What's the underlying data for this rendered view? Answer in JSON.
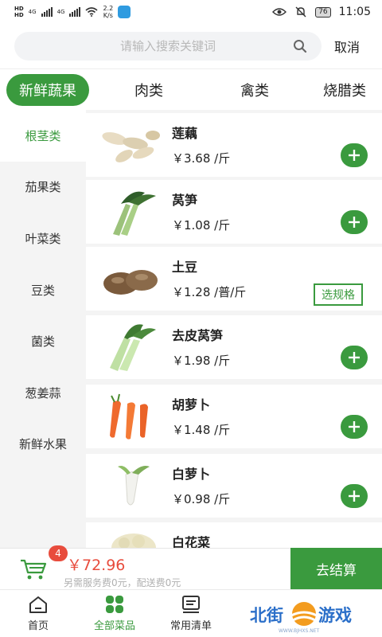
{
  "status_bar": {
    "left_text_1": "HD",
    "left_text_2": "HD",
    "net_4g_1": "4G",
    "net_4g_2": "4G",
    "net_speed": "2.2",
    "net_unit": "K/s",
    "battery": "76",
    "time": "11:05"
  },
  "search": {
    "placeholder": "请输入搜索关键词",
    "cancel_label": "取消"
  },
  "tabs": [
    {
      "label": "新鲜蔬果",
      "active": true
    },
    {
      "label": "肉类",
      "active": false
    },
    {
      "label": "禽类",
      "active": false
    },
    {
      "label": "烧腊类",
      "active": false
    }
  ],
  "sidebar": [
    {
      "label": "根茎类",
      "active": true
    },
    {
      "label": "茄果类",
      "active": false
    },
    {
      "label": "叶菜类",
      "active": false
    },
    {
      "label": "豆类",
      "active": false
    },
    {
      "label": "菌类",
      "active": false
    },
    {
      "label": "葱姜蒜",
      "active": false
    },
    {
      "label": "新鲜水果",
      "active": false
    }
  ],
  "products": [
    {
      "name": "莲藕",
      "price": "￥3.68 /斤",
      "action": "add"
    },
    {
      "name": "莴笋",
      "price": "￥1.08 /斤",
      "action": "add"
    },
    {
      "name": "土豆",
      "price": "￥1.28 /普/斤",
      "action": "spec",
      "action_label": "选规格"
    },
    {
      "name": "去皮莴笋",
      "price": "￥1.98 /斤",
      "action": "add"
    },
    {
      "name": "胡萝卜",
      "price": "￥1.48 /斤",
      "action": "add"
    },
    {
      "name": "白萝卜",
      "price": "￥0.98 /斤",
      "action": "add"
    },
    {
      "name": "白花菜",
      "price": "",
      "action": "none"
    }
  ],
  "cart": {
    "badge_count": "4",
    "total": "￥72.96",
    "fee_note": "另需服务费0元，配送费0元",
    "checkout_label": "去结算"
  },
  "bottom_nav": [
    {
      "label": "首页",
      "icon": "home-icon",
      "active": false
    },
    {
      "label": "全部菜品",
      "icon": "grid-icon",
      "active": true
    },
    {
      "label": "常用清单",
      "icon": "list-icon",
      "active": false
    }
  ],
  "watermark": {
    "text_left": "北街",
    "text_right": "游戏",
    "url": "WWW.BJHXS.NET"
  },
  "colors": {
    "accent": "#3a9a3e",
    "price_red": "#e84c3d"
  }
}
